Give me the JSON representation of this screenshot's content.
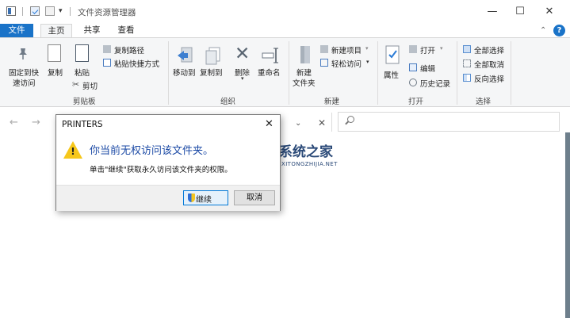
{
  "window": {
    "title": "文件资源管理器",
    "qa_dropdown": "▾",
    "minimize": "—",
    "maximize": "☐",
    "close": "✕"
  },
  "ribbon_tabs": {
    "file": "文件",
    "home": "主页",
    "share": "共享",
    "view": "查看"
  },
  "ribbon": {
    "clipboard": {
      "pin_line1": "固定到快",
      "pin_line2": "速访问",
      "copy": "复制",
      "paste": "粘贴",
      "copy_path": "复制路径",
      "paste_shortcut": "粘贴快捷方式",
      "cut": "剪切",
      "group": "剪贴板"
    },
    "organize": {
      "move_to": "移动到",
      "copy_to": "复制到",
      "delete": "删除",
      "rename": "重命名",
      "group": "组织"
    },
    "new": {
      "new_folder_line1": "新建",
      "new_folder_line2": "文件夹",
      "new_item": "新建项目",
      "easy_access": "轻松访问",
      "group": "新建"
    },
    "open": {
      "properties": "属性",
      "open": "打开",
      "edit": "编辑",
      "history": "历史记录",
      "group": "打开"
    },
    "select": {
      "select_all": "全部选择",
      "select_none": "全部取消",
      "invert": "反向选择",
      "group": "选择"
    }
  },
  "dialog": {
    "title": "PRINTERS",
    "close": "✕",
    "warning_mark": "!",
    "main_text": "你当前无权访问该文件夹。",
    "sub_text": "单击\"继续\"获取永久访问该文件夹的权限。",
    "continue_label": "继续",
    "cancel_label": "取消"
  },
  "watermark": {
    "name": "系统之家",
    "domain": "XITONGZHIJIA.NET"
  },
  "colors": {
    "accent": "#1a73c8",
    "dialog_text": "#1d4ba6",
    "warning": "#f6c71b"
  }
}
